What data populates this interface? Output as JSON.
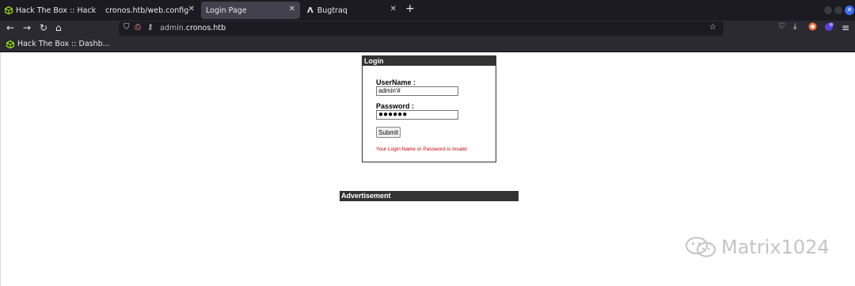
{
  "tabs": [
    {
      "label": "Hack The Box :: Hack The",
      "icon": "hackthebox-icon"
    },
    {
      "label": "cronos.htb/web.config"
    },
    {
      "label": "Login Page",
      "active": true
    },
    {
      "label": "Bugtraq",
      "icon": "bugtraq-icon"
    }
  ],
  "navbar": {
    "url_prefix": "admin.",
    "url_domain": "cronos.htb"
  },
  "bookmarks": [
    {
      "label": "Hack The Box :: Dashb..."
    }
  ],
  "login": {
    "header": "Login",
    "username_label": "UserName :",
    "username_value": "admin'#",
    "password_label": "Password :",
    "password_value": "●●●●●●",
    "submit_label": "Submit",
    "error": "Your Login Name or Password is invalid"
  },
  "advertisement": {
    "header": "Advertisement"
  },
  "watermark": {
    "text": "Matrix1024"
  },
  "colors": {
    "box_header_bg": "#333333",
    "error_text": "#cc0000",
    "browser_chrome": "#2b2a33"
  }
}
